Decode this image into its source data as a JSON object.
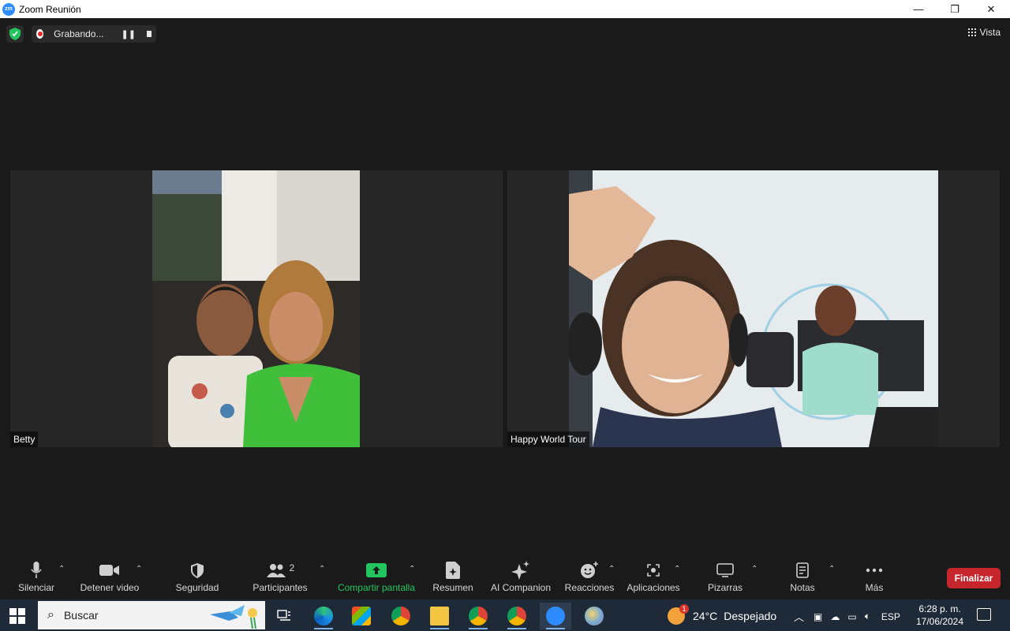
{
  "window": {
    "app_icon_text": "zm",
    "title": "Zoom Reunión",
    "minimize": "—",
    "maximize": "❐",
    "close": "✕"
  },
  "recording": {
    "status": "Grabando...",
    "pause_glyph": "❚❚"
  },
  "view_button": "Vista",
  "participants": [
    {
      "name": "Betty"
    },
    {
      "name": "Happy World Tour"
    }
  ],
  "toolbar": {
    "mute": "Silenciar",
    "video": "Detener video",
    "security": "Seguridad",
    "participants": "Participantes",
    "participants_count": "2",
    "share": "Compartir pantalla",
    "summary": "Resumen",
    "ai": "AI Companion",
    "reactions": "Reacciones",
    "apps": "Aplicaciones",
    "whiteboards": "Pizarras",
    "notes": "Notas",
    "more": "Más",
    "end": "Finalizar"
  },
  "colors": {
    "zoom_blue": "#2D8CFF",
    "share_green": "#22c55e",
    "end_red": "#c6252c",
    "shield_green": "#23c45e"
  },
  "taskbar": {
    "search_placeholder": "Buscar",
    "weather_badge": "1",
    "temperature": "24°C",
    "condition": "Despejado",
    "language": "ESP",
    "time": "6:28 p. m.",
    "date": "17/06/2024"
  }
}
